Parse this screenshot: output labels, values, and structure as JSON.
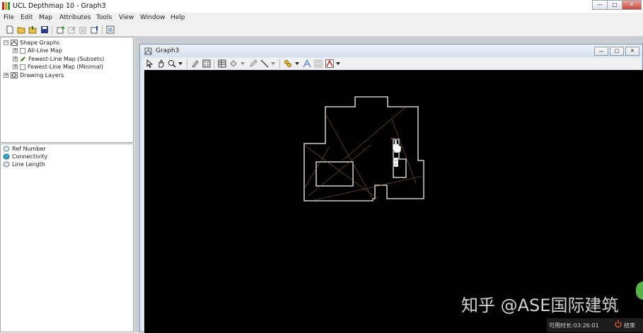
{
  "window": {
    "title": "UCL Depthmap 10 - Graph3",
    "controls": [
      "—",
      "□",
      "✕"
    ]
  },
  "menu": [
    "File",
    "Edit",
    "Map",
    "Attributes",
    "Tools",
    "View",
    "Window",
    "Help"
  ],
  "toolbar_icons": [
    "new-icon",
    "open-icon",
    "import-icon",
    "save-icon",
    "add-layer-icon",
    "edit-layer-icon",
    "delete-layer-icon",
    "push-icon",
    "export-icon"
  ],
  "tree": {
    "root": "Shape Graphs",
    "children": [
      "All-Line Map",
      "Fewest-Line Map (Subsets)",
      "Fewest-Line Map (Minimal)"
    ],
    "drawing": "Drawing Layers"
  },
  "attributes": [
    "Ref Number",
    "Connectivity",
    "Line Length"
  ],
  "child_window": {
    "title": "Graph3",
    "controls": [
      "—",
      "□",
      "✕"
    ]
  },
  "status": {
    "time": "可用时长:03:26:01",
    "end_label": "结束"
  },
  "watermark": "知乎 @ASE国际建筑"
}
